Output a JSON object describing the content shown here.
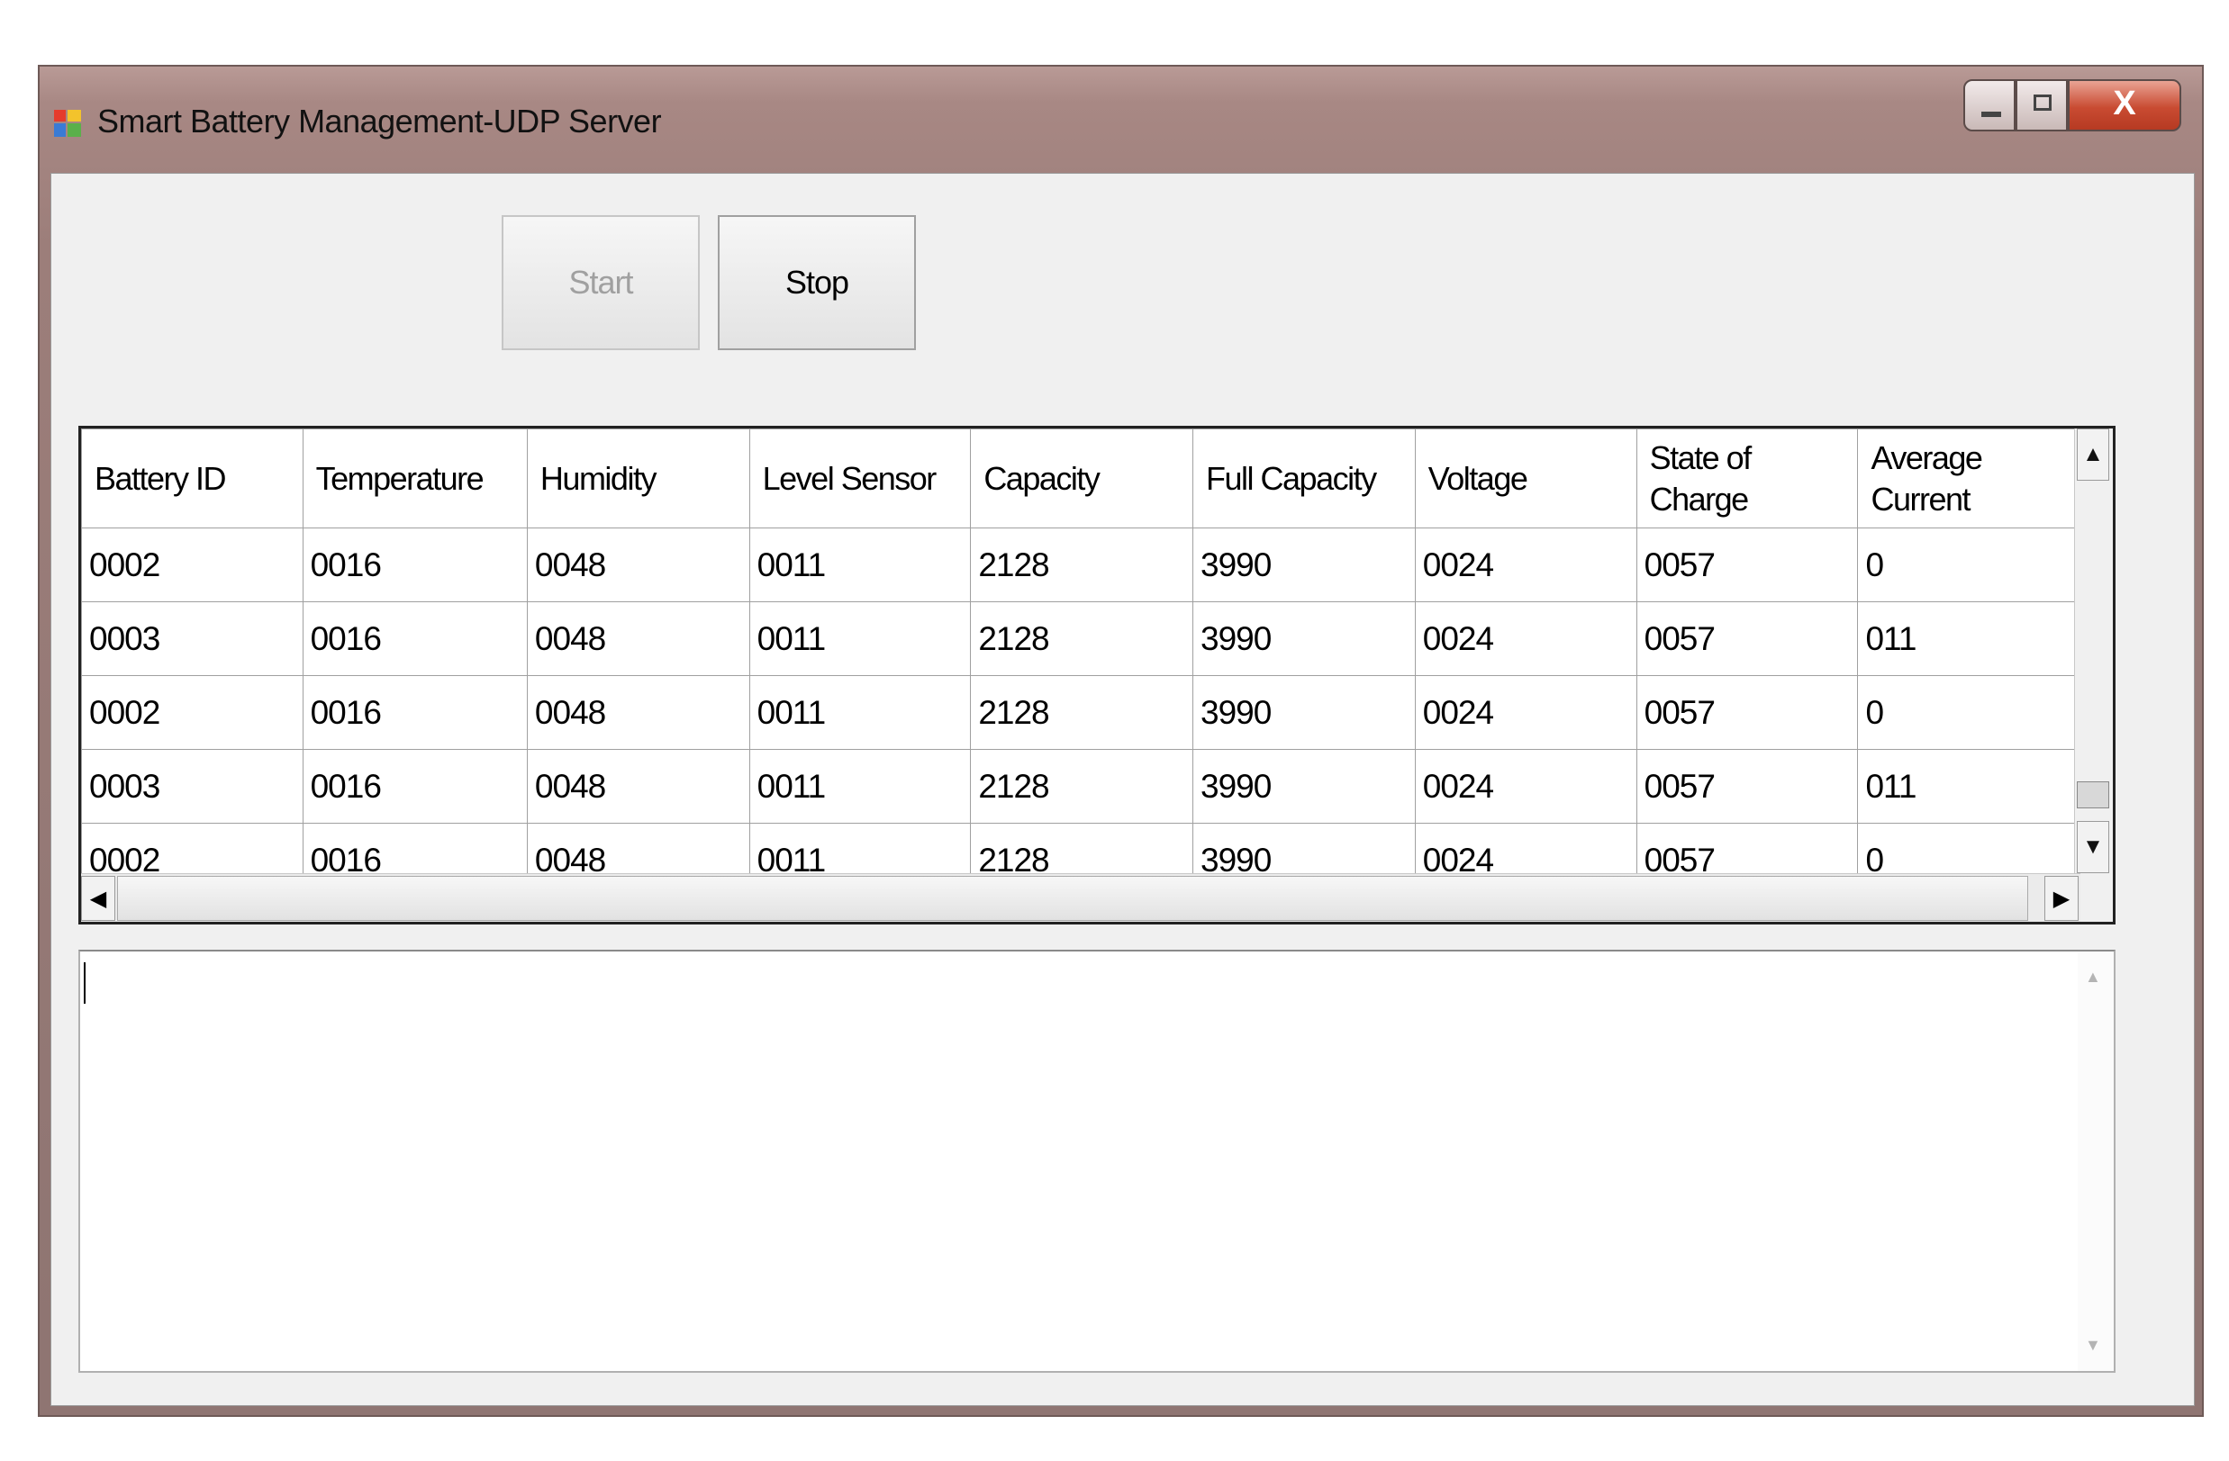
{
  "window": {
    "title": "Smart Battery Management-UDP Server"
  },
  "controls": {
    "minimize_icon": "minimize-icon",
    "maximize_icon": "maximize-icon",
    "close_label": "X"
  },
  "toolbar": {
    "start_label": "Start",
    "stop_label": "Stop",
    "start_enabled": false
  },
  "grid": {
    "columns": [
      "Battery ID",
      "Temperature",
      "Humidity",
      "Level Sensor",
      "Capacity",
      "Full Capacity",
      "Voltage",
      "State of Charge",
      "Average Current"
    ],
    "rows": [
      [
        "0002",
        "0016",
        "0048",
        "0011",
        "2128",
        "3990",
        "0024",
        "0057",
        "0"
      ],
      [
        "0003",
        "0016",
        "0048",
        "0011",
        "2128",
        "3990",
        "0024",
        "0057",
        "011"
      ],
      [
        "0002",
        "0016",
        "0048",
        "0011",
        "2128",
        "3990",
        "0024",
        "0057",
        "0"
      ],
      [
        "0003",
        "0016",
        "0048",
        "0011",
        "2128",
        "3990",
        "0024",
        "0057",
        "011"
      ],
      [
        "0002",
        "0016",
        "0048",
        "0011",
        "2128",
        "3990",
        "0024",
        "0057",
        "0"
      ]
    ]
  },
  "log": {
    "text": ""
  }
}
